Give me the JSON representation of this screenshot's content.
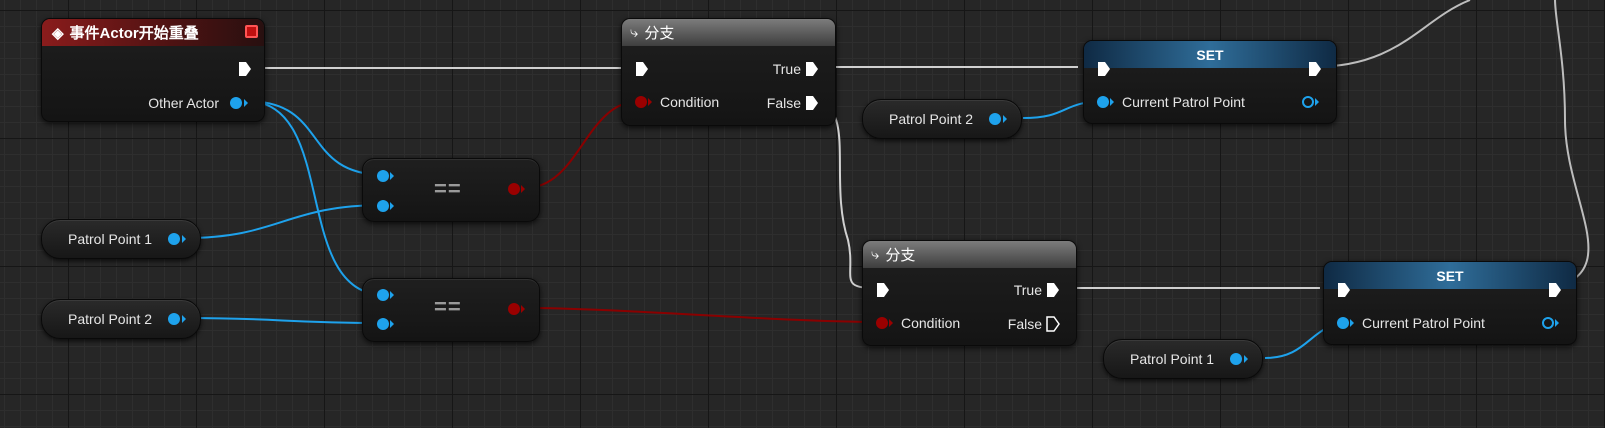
{
  "event_node": {
    "title": "事件Actor开始重叠",
    "output_label": "Other Actor"
  },
  "variables": {
    "patrol_point_1_a": "Patrol Point 1",
    "patrol_point_2_a": "Patrol Point 2",
    "patrol_point_2_b": "Patrol Point 2",
    "patrol_point_1_b": "Patrol Point 1"
  },
  "equals_nodes": {
    "symbol": "=="
  },
  "branch_1": {
    "title": "分支",
    "true_label": "True",
    "false_label": "False",
    "condition_label": "Condition"
  },
  "branch_2": {
    "title": "分支",
    "true_label": "True",
    "false_label": "False",
    "condition_label": "Condition"
  },
  "set_1": {
    "title": "SET",
    "input_label": "Current Patrol Point"
  },
  "set_2": {
    "title": "SET",
    "input_label": "Current Patrol Point"
  },
  "colors": {
    "object_pin": "#1ea2ec",
    "bool_pin": "#9a0000",
    "exec_wire": "#d8d8d8",
    "event_header": "#8a1c1c",
    "set_header": "#2f6d99"
  },
  "icons": {
    "event": "event-diamond-icon",
    "branch": "branch-icon",
    "stop": "stop-square-icon",
    "exec": "exec-pin-icon"
  }
}
